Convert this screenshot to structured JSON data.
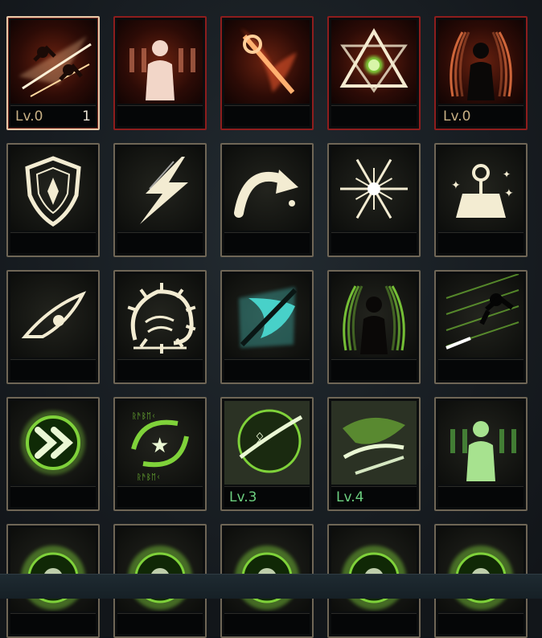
{
  "skills": [
    {
      "id": "dash-slash",
      "icon": "dash-slash",
      "theme": "red",
      "selected": true,
      "level": "Lv.0",
      "count": "1"
    },
    {
      "id": "crowd-figure",
      "icon": "crowd-figure",
      "theme": "red",
      "level": "",
      "count": ""
    },
    {
      "id": "flame-blade",
      "icon": "flame-blade",
      "theme": "red",
      "level": "",
      "count": ""
    },
    {
      "id": "triangle-emblem",
      "icon": "triangle-emblem",
      "theme": "red",
      "level": "",
      "count": ""
    },
    {
      "id": "aura-figure-red",
      "icon": "aura-figure",
      "theme": "red",
      "level": "Lv.0",
      "count": ""
    },
    {
      "id": "shield",
      "icon": "shield",
      "theme": "tan",
      "level": "",
      "count": ""
    },
    {
      "id": "lightning",
      "icon": "lightning",
      "theme": "tan",
      "level": "",
      "count": ""
    },
    {
      "id": "curve-arrow",
      "icon": "curve-arrow",
      "theme": "tan",
      "level": "",
      "count": ""
    },
    {
      "id": "burst",
      "icon": "burst",
      "theme": "tan",
      "level": "",
      "count": ""
    },
    {
      "id": "anvil",
      "icon": "anvil",
      "theme": "tan",
      "level": "",
      "count": ""
    },
    {
      "id": "eye",
      "icon": "eye",
      "theme": "tan",
      "level": "",
      "count": ""
    },
    {
      "id": "spiked-head",
      "icon": "spiked-head",
      "theme": "tan",
      "level": "",
      "count": ""
    },
    {
      "id": "cyan-slash",
      "icon": "cyan-slash",
      "theme": "tan",
      "level": "",
      "count": ""
    },
    {
      "id": "aura-figure-green",
      "icon": "aura-figure",
      "theme": "tan",
      "level": "",
      "count": ""
    },
    {
      "id": "green-dash",
      "icon": "green-dash",
      "theme": "tan",
      "level": "",
      "count": ""
    },
    {
      "id": "double-chevron",
      "icon": "double-chevron",
      "theme": "tan",
      "level": "",
      "count": ""
    },
    {
      "id": "star-rune",
      "icon": "star-rune",
      "theme": "tan",
      "level": "",
      "count": ""
    },
    {
      "id": "rune-orb",
      "icon": "rune-orb",
      "theme": "tan",
      "level": "Lv.3",
      "count": "",
      "greenlv": true
    },
    {
      "id": "blade-swirl",
      "icon": "blade-swirl",
      "theme": "tan",
      "level": "Lv.4",
      "count": "",
      "greenlv": true
    },
    {
      "id": "crowd-figure-green",
      "icon": "crowd-figure",
      "theme": "tan",
      "level": "",
      "count": ""
    },
    {
      "id": "row5-a",
      "icon": "green-orb",
      "theme": "tan",
      "level": "",
      "count": ""
    },
    {
      "id": "row5-b",
      "icon": "green-orb",
      "theme": "tan",
      "level": "",
      "count": ""
    },
    {
      "id": "row5-c",
      "icon": "green-orb",
      "theme": "tan",
      "level": "",
      "count": ""
    },
    {
      "id": "row5-d",
      "icon": "green-orb",
      "theme": "tan",
      "level": "",
      "count": ""
    },
    {
      "id": "row5-e",
      "icon": "green-orb",
      "theme": "tan",
      "level": "",
      "count": ""
    }
  ],
  "colors": {
    "red_border": "#8e1d1d",
    "tan_border": "#6f6656",
    "level_text": "#c8b084",
    "level_text_green": "#6ccf7f",
    "glow_green": "#7fd23a",
    "glow_cream": "#f3ecd2",
    "glow_red": "#e0532a",
    "glow_cyan": "#48d1c9"
  }
}
